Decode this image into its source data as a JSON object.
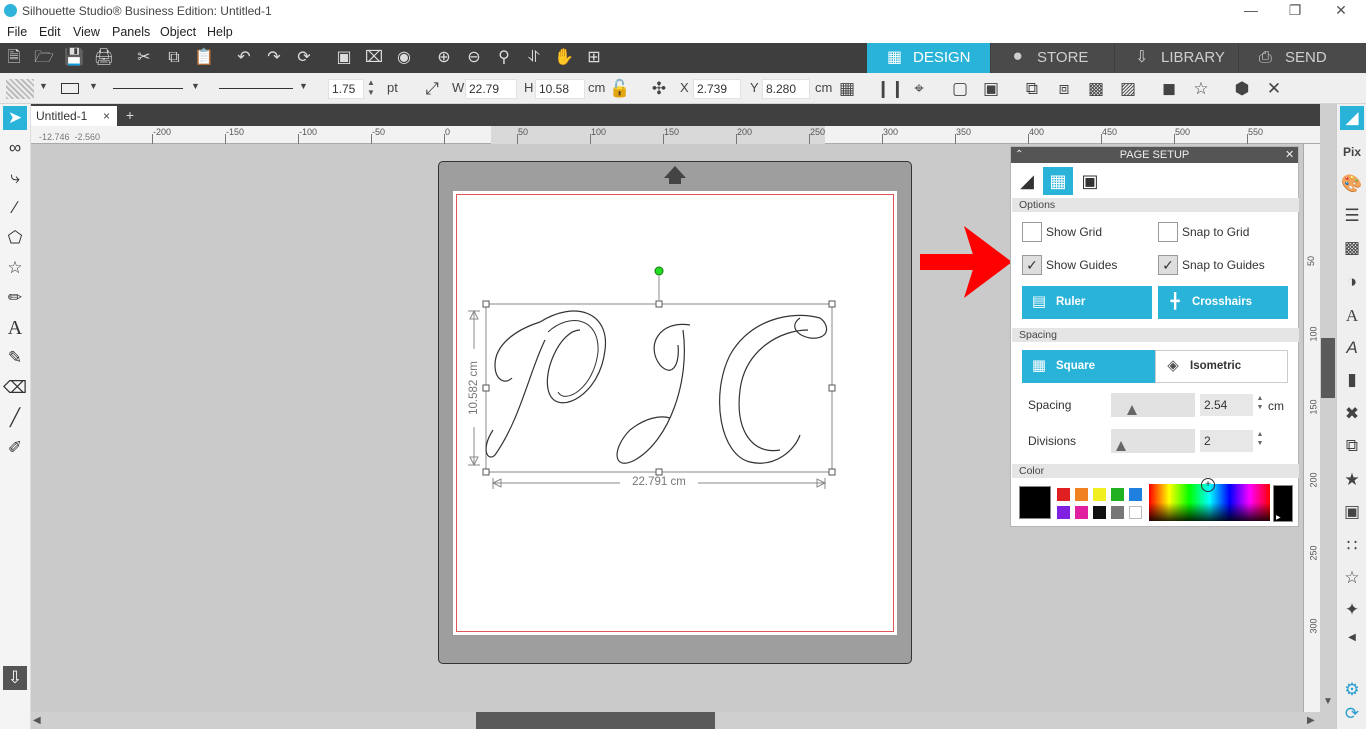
{
  "window": {
    "title": "Silhouette Studio® Business Edition: Untitled-1"
  },
  "menu": {
    "items": [
      "File",
      "Edit",
      "View",
      "Panels",
      "Object",
      "Help"
    ]
  },
  "nav_tabs": [
    {
      "label": "DESIGN",
      "active": true
    },
    {
      "label": "STORE",
      "active": false
    },
    {
      "label": "LIBRARY",
      "active": false
    },
    {
      "label": "SEND",
      "active": false
    }
  ],
  "line_props": {
    "weight": "1.75",
    "unit": "pt"
  },
  "size": {
    "w_label": "W",
    "w": "22.79",
    "h_label": "H",
    "h": "10.58",
    "unit": "cm"
  },
  "position": {
    "x_label": "X",
    "x": "2.739",
    "y_label": "Y",
    "y": "8.280",
    "unit": "cm"
  },
  "doc_tab": {
    "name": "Untitled-1"
  },
  "cursor_readout": {
    "x": "-12.746",
    "y": "-2.560"
  },
  "ruler_h": [
    "-200",
    "-150",
    "-100",
    "-50",
    "0",
    "50",
    "100",
    "150",
    "200",
    "250",
    "300",
    "350",
    "400",
    "450",
    "500",
    "550"
  ],
  "ruler_v": [
    "50",
    "100",
    "150",
    "200",
    "250",
    "300"
  ],
  "selection": {
    "height_label": "10.582 cm",
    "width_label": "22.791 cm"
  },
  "page_setup": {
    "title": "PAGE SETUP",
    "options_label": "Options",
    "show_grid": {
      "label": "Show Grid",
      "checked": false
    },
    "snap_to_grid": {
      "label": "Snap to Grid",
      "checked": false
    },
    "show_guides": {
      "label": "Show Guides",
      "checked": true
    },
    "snap_to_guides": {
      "label": "Snap to Guides",
      "checked": true
    },
    "ruler_button": "Ruler",
    "crosshairs_button": "Crosshairs",
    "spacing_section": "Spacing",
    "square_button": "Square",
    "isometric_button": "Isometric",
    "spacing_label": "Spacing",
    "spacing_value": "2.54",
    "spacing_unit": "cm",
    "divisions_label": "Divisions",
    "divisions_value": "2",
    "color_section": "Color",
    "current_color": "#000000",
    "swatches": [
      "#e02020",
      "#f08020",
      "#f0f020",
      "#20b020",
      "#2080e0",
      "#8020e0",
      "#e020a0",
      "#111111",
      "#777777",
      "#ffffff"
    ]
  },
  "annotation": {
    "arrow_color": "#ff0000"
  }
}
